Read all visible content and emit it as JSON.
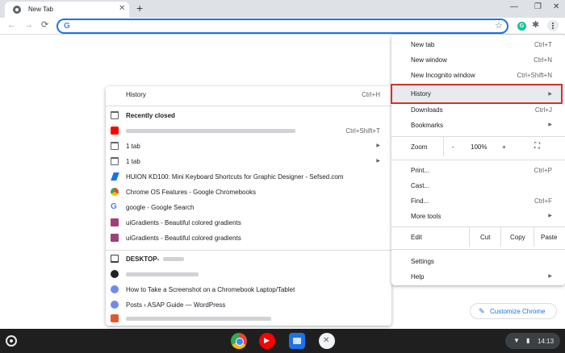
{
  "tab": {
    "title": "New Tab",
    "close": "✕"
  },
  "tabstrip": {
    "new_tab": "+",
    "minimize": "—",
    "restore": "❐",
    "close": "✕"
  },
  "toolbar": {
    "back": "←",
    "forward": "→",
    "reload": "⟳",
    "omnibox_logo": "G",
    "omnibox_value": "",
    "star": "☆",
    "grammarly": "G",
    "extensions": "✱"
  },
  "menu": {
    "new_tab": {
      "label": "New tab",
      "shortcut": "Ctrl+T"
    },
    "new_window": {
      "label": "New window",
      "shortcut": "Ctrl+N"
    },
    "new_incognito": {
      "label": "New Incognito window",
      "shortcut": "Ctrl+Shift+N"
    },
    "history": {
      "label": "History",
      "arrow": "▶"
    },
    "downloads": {
      "label": "Downloads",
      "shortcut": "Ctrl+J"
    },
    "bookmarks": {
      "label": "Bookmarks",
      "arrow": "▶"
    },
    "zoom": {
      "label": "Zoom",
      "minus": "-",
      "level": "100%",
      "plus": "+",
      "fullscreen": "⛶"
    },
    "print": {
      "label": "Print...",
      "shortcut": "Ctrl+P"
    },
    "cast": {
      "label": "Cast..."
    },
    "find": {
      "label": "Find...",
      "shortcut": "Ctrl+F"
    },
    "more_tools": {
      "label": "More tools",
      "arrow": "▶"
    },
    "edit": {
      "label": "Edit",
      "cut": "Cut",
      "copy": "Copy",
      "paste": "Paste"
    },
    "settings": {
      "label": "Settings"
    },
    "help": {
      "label": "Help",
      "arrow": "▶"
    }
  },
  "history_menu": {
    "history": {
      "label": "History",
      "shortcut": "Ctrl+H"
    },
    "recently_closed": "Recently closed",
    "items": [
      {
        "label": "",
        "shortcut": "Ctrl+Shift+T",
        "icon": "youtube-icon"
      },
      {
        "label": "1 tab",
        "arrow": "▶",
        "icon": "window-icon"
      },
      {
        "label": "1 tab",
        "arrow": "▶",
        "icon": "window-icon"
      },
      {
        "label": "HUION KD100: Mini Keyboard Shortcuts for Graphic Designer - Sefsed.com",
        "icon": "huion-icon"
      },
      {
        "label": "Chrome OS Features - Google Chromebooks",
        "icon": "chrome-icon"
      },
      {
        "label": "google - Google Search",
        "icon": "google-icon"
      },
      {
        "label": "uiGradients - Beautiful colored gradients",
        "icon": "gradient-icon"
      },
      {
        "label": "uiGradients - Beautiful colored gradients",
        "icon": "gradient-icon"
      }
    ],
    "device": "DESKTOP-",
    "device_items": [
      {
        "label": "",
        "icon": "site-icon"
      },
      {
        "label": "How to Take a Screenshot on a Chromebook Laptop/Tablet",
        "icon": "wordpress-icon"
      },
      {
        "label": "Posts ‹ ASAP Guide — WordPress",
        "icon": "wordpress-icon"
      },
      {
        "label": "",
        "icon": "site-icon"
      }
    ]
  },
  "customize": {
    "label": "Customize Chrome",
    "icon": "✎"
  },
  "shelf": {
    "time": "14:13",
    "wifi": "▼",
    "battery": "▮"
  },
  "colors": {
    "accent": "#1a73e8",
    "highlight_border": "#d93025",
    "shelf": "#1f1f1f"
  }
}
